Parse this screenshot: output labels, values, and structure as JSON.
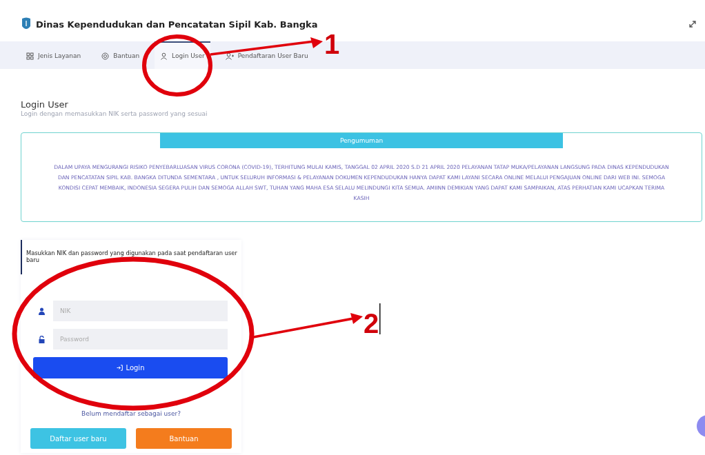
{
  "header": {
    "title": "Dinas Kependudukan dan Pencatatan Sipil Kab. Bangka"
  },
  "tabs": [
    {
      "label": "Jenis Layanan",
      "selected": false
    },
    {
      "label": "Bantuan",
      "selected": false
    },
    {
      "label": "Login User",
      "selected": true
    },
    {
      "label": "Pendaftaran User Baru",
      "selected": false
    }
  ],
  "page": {
    "title": "Login User",
    "subtitle": "Login dengan memasukkan NIK serta password yang sesuai"
  },
  "announcement": {
    "title": "Pengumuman",
    "text": "DALAM UPAYA MENGURANGI RISIKO PENYEBARLUASAN VIRUS CORONA (COVID-19), TERHITUNG MULAI KAMIS, TANGGAL 02 APRIL 2020 S.D 21 APRIL 2020 PELAYANAN TATAP MUKA/PELAYANAN LANGSUNG PADA DINAS KEPENDUDUKAN DAN PENCATATAN SIPIL KAB. BANGKA DITUNDA SEMENTARA , UNTUK SELURUH INFORMASI & PELAYANAN DOKUMEN KEPENDUDUKAN HANYA DAPAT KAMI LAYANI SECARA ONLINE MELALUI PENGAJUAN ONLINE DARI WEB INI. SEMOGA KONDISI CEPAT MEMBAIK, INDONESIA SEGERA PULIH DAN SEMOGA ALLAH SWT, TUHAN YANG MAHA ESA SELALU MELINDUNGI KITA SEMUA. AMIINN DEMIKIAN YANG DAPAT KAMI SAMPAIKAN, ATAS PERHATIAN KAMI UCAPKAN TERIMA KASIH"
  },
  "login": {
    "message": "Masukkan NIK dan password yang digunakan pada saat pendaftaran user baru",
    "fields": [
      {
        "placeholder": "NIK"
      },
      {
        "placeholder": "Password"
      }
    ],
    "button": "Login",
    "register_prompt": "Belum mendaftar sebagai user?",
    "buttons": [
      {
        "label": "Daftar user baru",
        "kind": "register"
      },
      {
        "label": "Bantuan",
        "kind": "help"
      }
    ]
  },
  "annotations": [
    {
      "label": "1"
    },
    {
      "label": "2"
    }
  ]
}
